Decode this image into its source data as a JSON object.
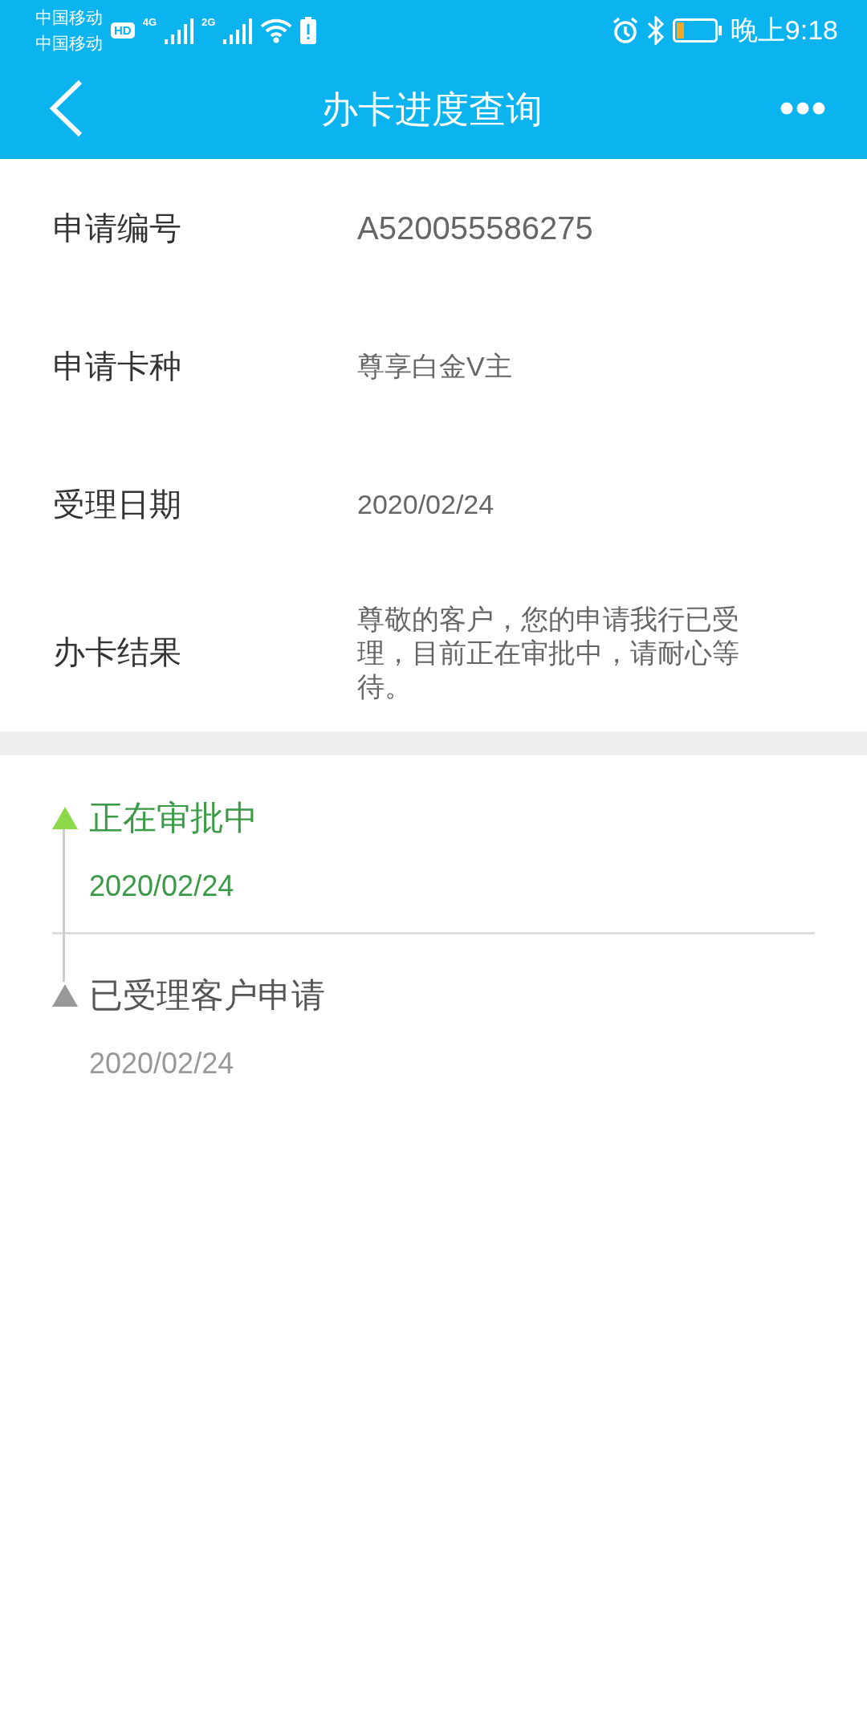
{
  "status_bar": {
    "carriers": [
      "中国移动",
      "中国移动"
    ],
    "hd_badge": "HD",
    "networks": [
      "4G",
      "2G"
    ],
    "time": "晚上9:18"
  },
  "app_bar": {
    "title": "办卡进度查询"
  },
  "details": [
    {
      "label": "申请编号",
      "value": "A520055586275",
      "kind": "number"
    },
    {
      "label": "申请卡种",
      "value": "尊享白金V主",
      "kind": "text"
    },
    {
      "label": "受理日期",
      "value": "2020/02/24",
      "kind": "text"
    },
    {
      "label": "办卡结果",
      "value": "尊敬的客户，您的申请我行已受理，目前正在审批中，请耐心等待。",
      "kind": "text"
    }
  ],
  "timeline": [
    {
      "title": "正在审批中",
      "date": "2020/02/24",
      "active": true
    },
    {
      "title": "已受理客户申请",
      "date": "2020/02/24",
      "active": false
    }
  ]
}
